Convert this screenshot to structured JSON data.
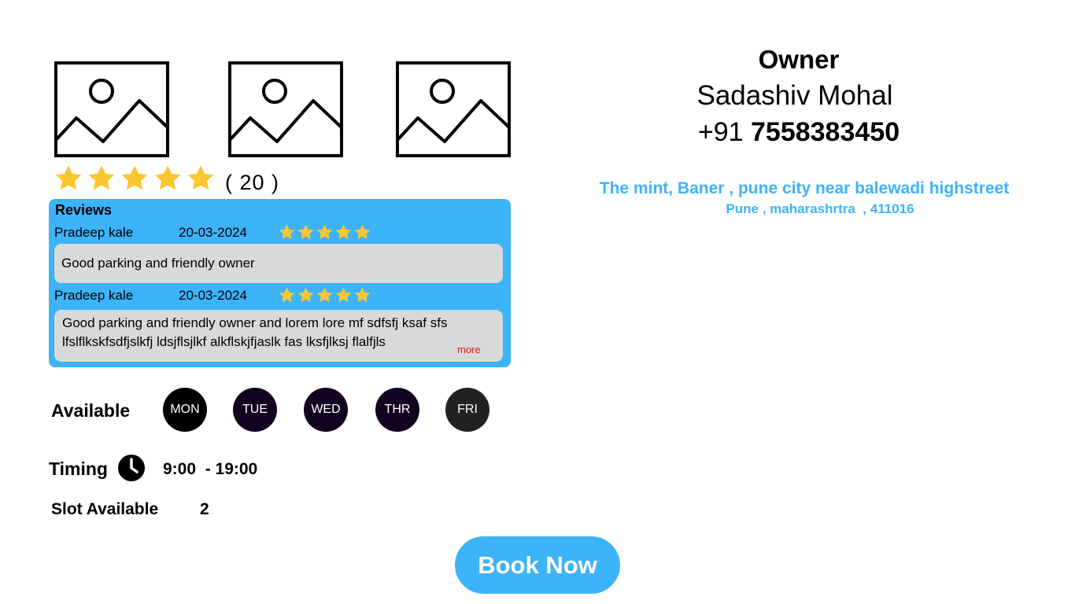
{
  "rating": {
    "stars": 5,
    "count_text": "( 20 )",
    "star_color": "#fbc62f"
  },
  "reviews": {
    "heading": "Reviews",
    "items": [
      {
        "name": "Pradeep kale",
        "date": "20-03-2024",
        "stars": 5,
        "text": "Good parking and friendly owner"
      },
      {
        "name": "Pradeep kale",
        "date": "20-03-2024",
        "stars": 5,
        "text": "Good parking and friendly owner and lorem lore mf sdfsfj ksaf sfs lfslflkskfsdfjslkfj ldsjflsjlkf alkflskjfjaslk fas lksfjlksj flalfjls",
        "more": "more"
      }
    ]
  },
  "availability": {
    "label": "Available",
    "days": [
      {
        "label": "MON",
        "color": "#000000"
      },
      {
        "label": "TUE",
        "color": "#120420"
      },
      {
        "label": "WED",
        "color": "#120420"
      },
      {
        "label": "THR",
        "color": "#120420"
      },
      {
        "label": "FRI",
        "color": "#222222"
      }
    ]
  },
  "timing": {
    "label": "Timing",
    "icon": "clock-icon",
    "value": "9:00  - 19:00"
  },
  "slots": {
    "label": "Slot Available",
    "value": "2"
  },
  "book_button": "Book Now",
  "owner": {
    "title": "Owner",
    "name": "Sadashiv Mohal",
    "phone_prefix": "+91",
    "phone_number": "7558383450"
  },
  "address": {
    "line1": "The mint, Baner , pune city near balewadi highstreet",
    "line2": "Pune , maharashrtra  , 411016"
  },
  "colors": {
    "accent": "#3db3fa",
    "review_bg": "#d9d9d9",
    "more_link": "#d0201e"
  }
}
